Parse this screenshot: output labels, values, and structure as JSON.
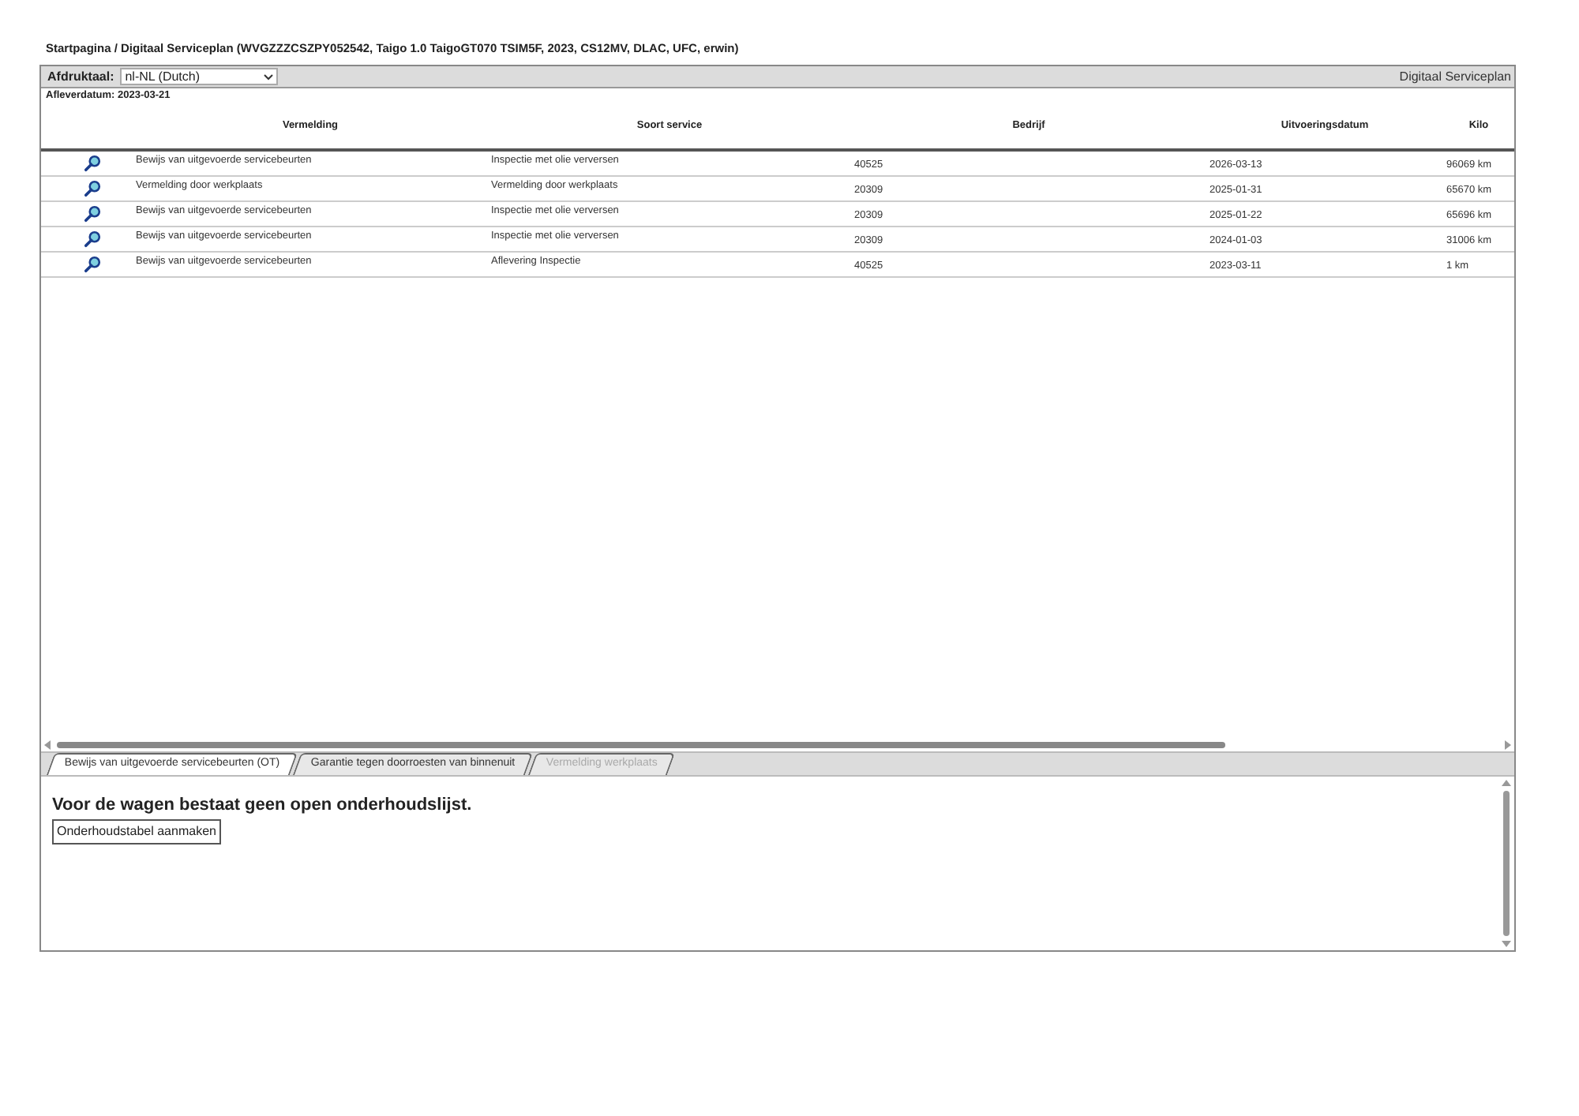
{
  "breadcrumb": "Startpagina / Digitaal Serviceplan (WVGZZZCSZPY052542, Taigo 1.0 TaigoGT070 TSIM5F, 2023, CS12MV, DLAC, UFC, erwin)",
  "toolbar": {
    "language_label": "Afdruktaal:",
    "language_value": "nl-NL (Dutch)",
    "title": "Digitaal Serviceplan"
  },
  "delivery_date": "Afleverdatum: 2023-03-21",
  "table": {
    "columns": [
      "Vermelding",
      "Soort service",
      "Bedrijf",
      "Uitvoeringsdatum",
      "Kilo"
    ],
    "rows": [
      {
        "cells": [
          "Bewijs van uitgevoerde servicebeurten",
          "Inspectie met olie verversen",
          "40525",
          "2026-03-13",
          "96069 km"
        ]
      },
      {
        "cells": [
          "Vermelding door werkplaats",
          "Vermelding door werkplaats",
          "20309",
          "2025-01-31",
          "65670 km"
        ]
      },
      {
        "cells": [
          "Bewijs van uitgevoerde servicebeurten",
          "Inspectie met olie verversen",
          "20309",
          "2025-01-22",
          "65696 km"
        ]
      },
      {
        "cells": [
          "Bewijs van uitgevoerde servicebeurten",
          "Inspectie met olie verversen",
          "20309",
          "2024-01-03",
          "31006 km"
        ]
      },
      {
        "cells": [
          "Bewijs van uitgevoerde servicebeurten",
          "Aflevering Inspectie",
          "40525",
          "2023-03-11",
          "1 km"
        ]
      }
    ]
  },
  "tabs": [
    {
      "label": "Bewijs van uitgevoerde servicebeurten (OT)",
      "selected": true,
      "disabled": false
    },
    {
      "label": "Garantie tegen doorroesten van binnenuit",
      "selected": false,
      "disabled": false
    },
    {
      "label": "Vermelding werkplaats",
      "selected": false,
      "disabled": true
    }
  ],
  "panel": {
    "message": "Voor de wagen bestaat geen open onderhoudslijst.",
    "button": "Onderhoudstabel aanmaken"
  }
}
